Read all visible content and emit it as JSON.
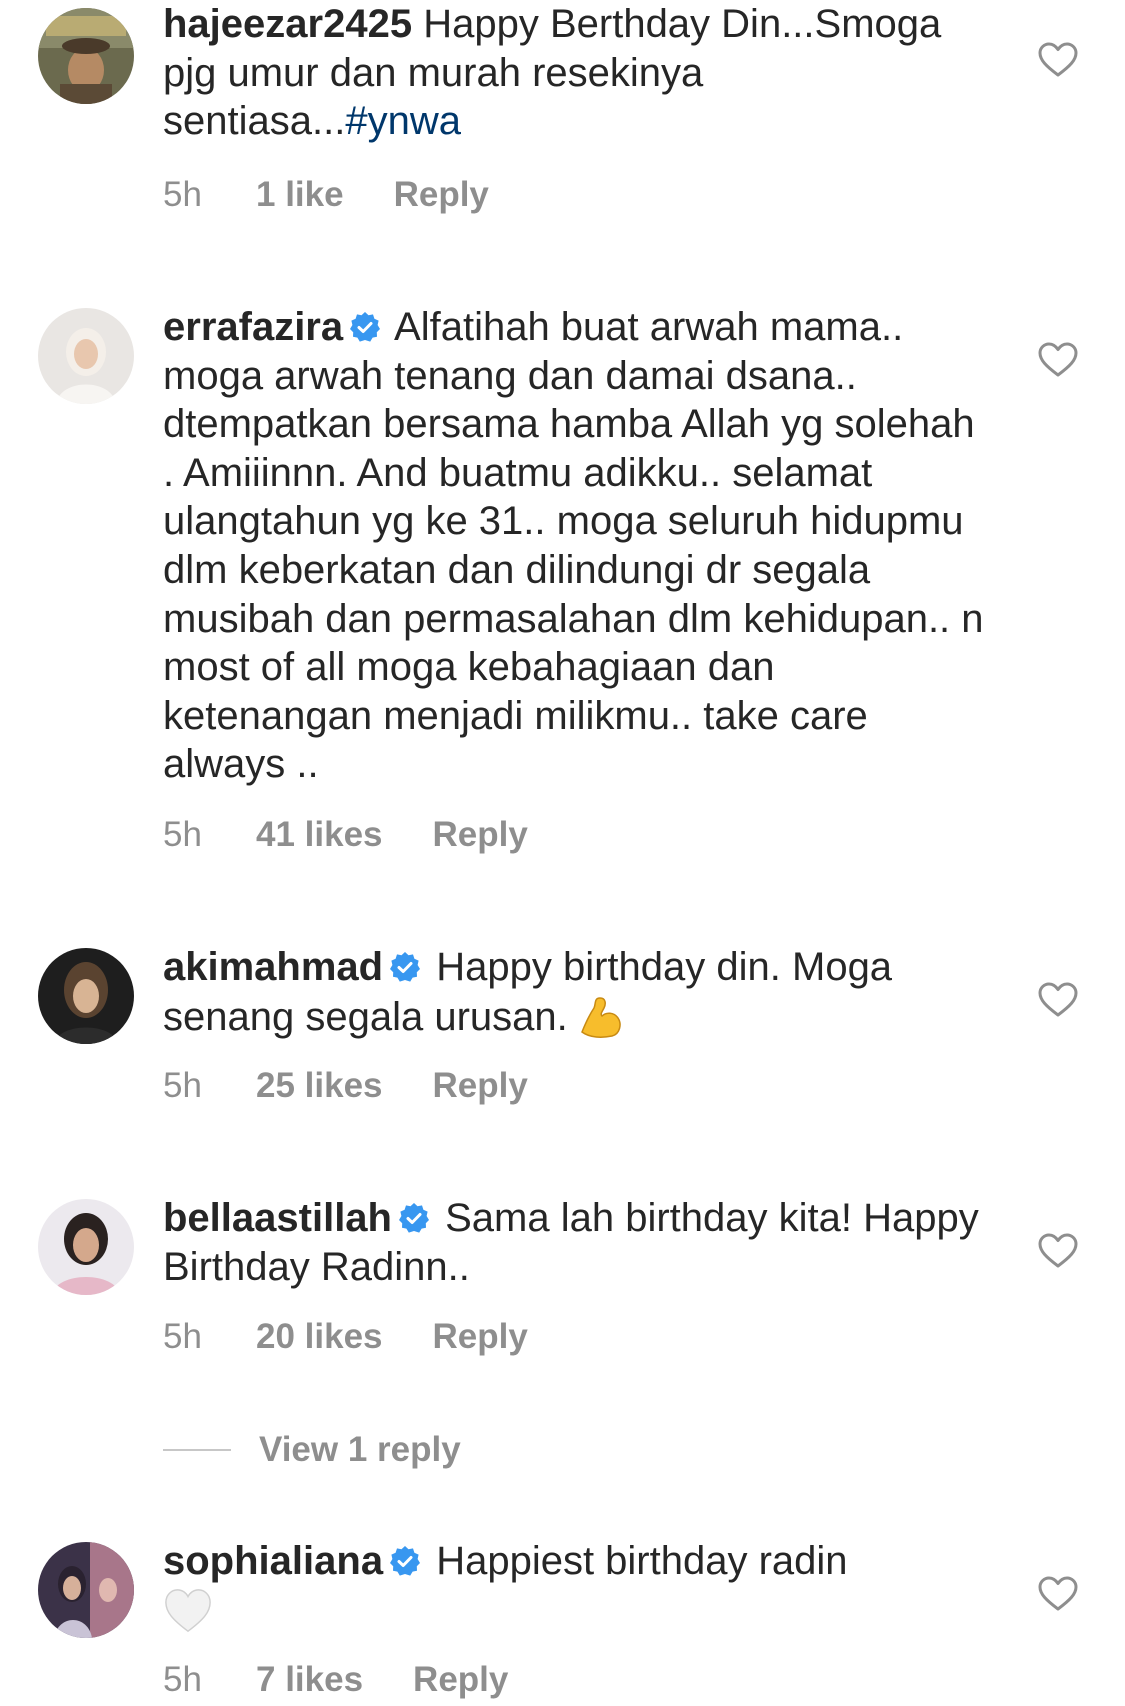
{
  "comments": [
    {
      "username": "hajeezar2425",
      "verified": false,
      "text": "Happy Berthday Din...Smoga pjg umur dan murah resekinya sentiasa...",
      "hashtag": "#ynwa",
      "time": "5h",
      "likes": "1 like",
      "reply": "Reply"
    },
    {
      "username": "errafazira",
      "verified": true,
      "text": "Alfatihah buat arwah mama.. moga arwah tenang dan damai dsana.. dtempatkan bersama hamba Allah yg solehah . Amiiinnn.  And buatmu adikku.. selamat ulangtahun yg ke 31.. moga seluruh hidupmu dlm keberkatan dan dilindungi dr segala musibah dan permasalahan dlm kehidupan.. n most of all moga kebahagiaan dan ketenangan menjadi milikmu.. take care always ..",
      "time": "5h",
      "likes": "41 likes",
      "reply": "Reply"
    },
    {
      "username": "akimahmad",
      "verified": true,
      "text": "Happy birthday din. Moga senang segala urusan.",
      "emoji": "flexed-biceps-emoji",
      "time": "5h",
      "likes": "25 likes",
      "reply": "Reply"
    },
    {
      "username": "bellaastillah",
      "verified": true,
      "text": "Sama lah birthday kita! Happy Birthday Radinn..",
      "time": "5h",
      "likes": "20 likes",
      "reply": "Reply",
      "view_replies": "View 1 reply"
    },
    {
      "username": "sophialiana",
      "verified": true,
      "text": "Happiest birthday radin",
      "emoji": "white-heart-emoji",
      "time": "5h",
      "likes": "7 likes",
      "reply": "Reply"
    }
  ],
  "colors": {
    "text": "#262626",
    "secondary": "#8e8e8e",
    "hashtag": "#00376b",
    "verified": "#3897f0"
  },
  "icons": {
    "like": "heart-outline-icon",
    "verified": "verified-badge-icon"
  }
}
